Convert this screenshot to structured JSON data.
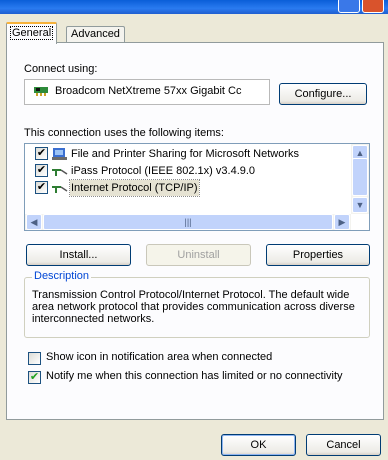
{
  "tabs": [
    {
      "label": "General",
      "active": true
    },
    {
      "label": "Advanced",
      "active": false
    }
  ],
  "connect_using": {
    "label": "Connect using:",
    "adapter": "Broadcom NetXtreme 57xx Gigabit Cc",
    "configure_label": "Configure..."
  },
  "items_label": "This connection uses the following items:",
  "items": [
    {
      "label": "File and Printer Sharing for Microsoft Networks",
      "checked": true,
      "icon": "printer-share-icon"
    },
    {
      "label": "iPass Protocol (IEEE 802.1x) v3.4.9.0",
      "checked": true,
      "icon": "network-protocol-icon"
    },
    {
      "label": "Internet Protocol (TCP/IP)",
      "checked": true,
      "icon": "network-protocol-icon",
      "selected": true
    }
  ],
  "buttons": {
    "install": "Install...",
    "uninstall": "Uninstall",
    "properties": "Properties",
    "ok": "OK",
    "cancel": "Cancel"
  },
  "description": {
    "legend": "Description",
    "text": "Transmission Control Protocol/Internet Protocol. The default wide area network protocol that provides communication across diverse interconnected networks."
  },
  "options": [
    {
      "label": "Show icon in notification area when connected",
      "checked": false
    },
    {
      "label": "Notify me when this connection has limited or no connectivity",
      "checked": true
    }
  ],
  "colors": {
    "accent": "#0046d5",
    "check": "#21a121",
    "tab_highlight": "#f7b23a"
  }
}
